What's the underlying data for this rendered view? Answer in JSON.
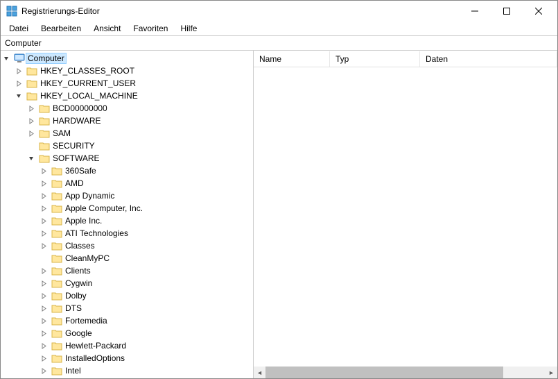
{
  "window": {
    "title": "Registrierungs-Editor"
  },
  "menu": {
    "file": "Datei",
    "edit": "Bearbeiten",
    "view": "Ansicht",
    "favorites": "Favoriten",
    "help": "Hilfe"
  },
  "addressbar": {
    "path": "Computer"
  },
  "list_columns": {
    "name": "Name",
    "type": "Typ",
    "data": "Daten"
  },
  "tree": {
    "root": {
      "label": "Computer",
      "expanded": true,
      "selected": true,
      "icon": "computer",
      "indent": 0,
      "children": [
        {
          "label": "HKEY_CLASSES_ROOT",
          "expander": ">",
          "indent": 1,
          "icon": "folder"
        },
        {
          "label": "HKEY_CURRENT_USER",
          "expander": ">",
          "indent": 1,
          "icon": "folder"
        },
        {
          "label": "HKEY_LOCAL_MACHINE",
          "expander": "v",
          "indent": 1,
          "icon": "folder",
          "children": [
            {
              "label": "BCD00000000",
              "expander": ">",
              "indent": 2,
              "icon": "folder"
            },
            {
              "label": "HARDWARE",
              "expander": ">",
              "indent": 2,
              "icon": "folder"
            },
            {
              "label": "SAM",
              "expander": ">",
              "indent": 2,
              "icon": "folder"
            },
            {
              "label": "SECURITY",
              "expander": "",
              "indent": 2,
              "icon": "folder"
            },
            {
              "label": "SOFTWARE",
              "expander": "v",
              "indent": 2,
              "icon": "folder",
              "children": [
                {
                  "label": "360Safe",
                  "expander": ">",
                  "indent": 3,
                  "icon": "folder"
                },
                {
                  "label": "AMD",
                  "expander": ">",
                  "indent": 3,
                  "icon": "folder"
                },
                {
                  "label": "App Dynamic",
                  "expander": ">",
                  "indent": 3,
                  "icon": "folder"
                },
                {
                  "label": "Apple Computer, Inc.",
                  "expander": ">",
                  "indent": 3,
                  "icon": "folder"
                },
                {
                  "label": "Apple Inc.",
                  "expander": ">",
                  "indent": 3,
                  "icon": "folder"
                },
                {
                  "label": "ATI Technologies",
                  "expander": ">",
                  "indent": 3,
                  "icon": "folder"
                },
                {
                  "label": "Classes",
                  "expander": ">",
                  "indent": 3,
                  "icon": "folder"
                },
                {
                  "label": "CleanMyPC",
                  "expander": "",
                  "indent": 3,
                  "icon": "folder"
                },
                {
                  "label": "Clients",
                  "expander": ">",
                  "indent": 3,
                  "icon": "folder"
                },
                {
                  "label": "Cygwin",
                  "expander": ">",
                  "indent": 3,
                  "icon": "folder"
                },
                {
                  "label": "Dolby",
                  "expander": ">",
                  "indent": 3,
                  "icon": "folder"
                },
                {
                  "label": "DTS",
                  "expander": ">",
                  "indent": 3,
                  "icon": "folder"
                },
                {
                  "label": "Fortemedia",
                  "expander": ">",
                  "indent": 3,
                  "icon": "folder"
                },
                {
                  "label": "Google",
                  "expander": ">",
                  "indent": 3,
                  "icon": "folder"
                },
                {
                  "label": "Hewlett-Packard",
                  "expander": ">",
                  "indent": 3,
                  "icon": "folder"
                },
                {
                  "label": "InstalledOptions",
                  "expander": ">",
                  "indent": 3,
                  "icon": "folder"
                },
                {
                  "label": "Intel",
                  "expander": ">",
                  "indent": 3,
                  "icon": "folder"
                }
              ]
            }
          ]
        }
      ]
    }
  }
}
